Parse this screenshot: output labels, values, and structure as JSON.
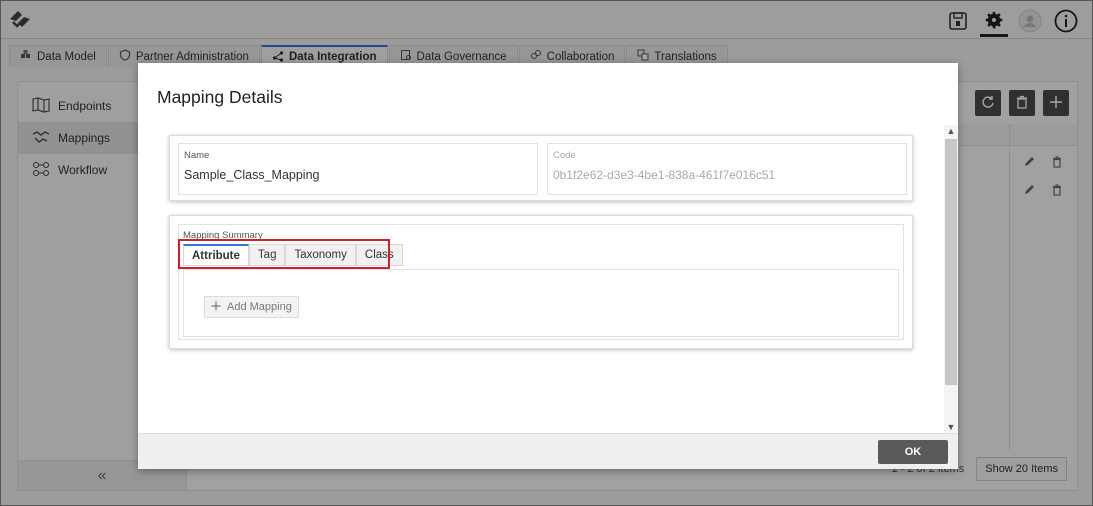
{
  "tabs": [
    {
      "label": "Data Model",
      "icon": "cubes-icon"
    },
    {
      "label": "Partner Administration",
      "icon": "shield-icon"
    },
    {
      "label": "Data Integration",
      "icon": "share-icon",
      "active": true
    },
    {
      "label": "Data Governance",
      "icon": "governance-icon"
    },
    {
      "label": "Collaboration",
      "icon": "collaboration-icon"
    },
    {
      "label": "Translations",
      "icon": "translate-icon"
    }
  ],
  "sidebar": {
    "items": [
      {
        "label": "Endpoints",
        "icon": "map-icon"
      },
      {
        "label": "Mappings",
        "icon": "handshake-icon",
        "active": true
      },
      {
        "label": "Workflow",
        "icon": "workflow-icon"
      }
    ],
    "collapse_glyph": "«"
  },
  "background": {
    "pager": "1 - 2 of 2 items",
    "show_button": "Show 20 Items"
  },
  "modal": {
    "title": "Mapping Details",
    "name": {
      "label": "Name",
      "value": "Sample_Class_Mapping"
    },
    "code": {
      "label": "Code",
      "value": "0b1f2e62-d3e3-4be1-838a-461f7e016c51"
    },
    "summary_label": "Mapping Summary",
    "mapping_tabs": [
      {
        "label": "Attribute",
        "active": true
      },
      {
        "label": "Tag"
      },
      {
        "label": "Taxonomy"
      },
      {
        "label": "Class"
      }
    ],
    "add_mapping_label": "Add Mapping",
    "ok_label": "OK"
  },
  "colors": {
    "accent": "#3b74d8",
    "highlight": "#d0202a",
    "dark_button": "#5a5a5a"
  }
}
